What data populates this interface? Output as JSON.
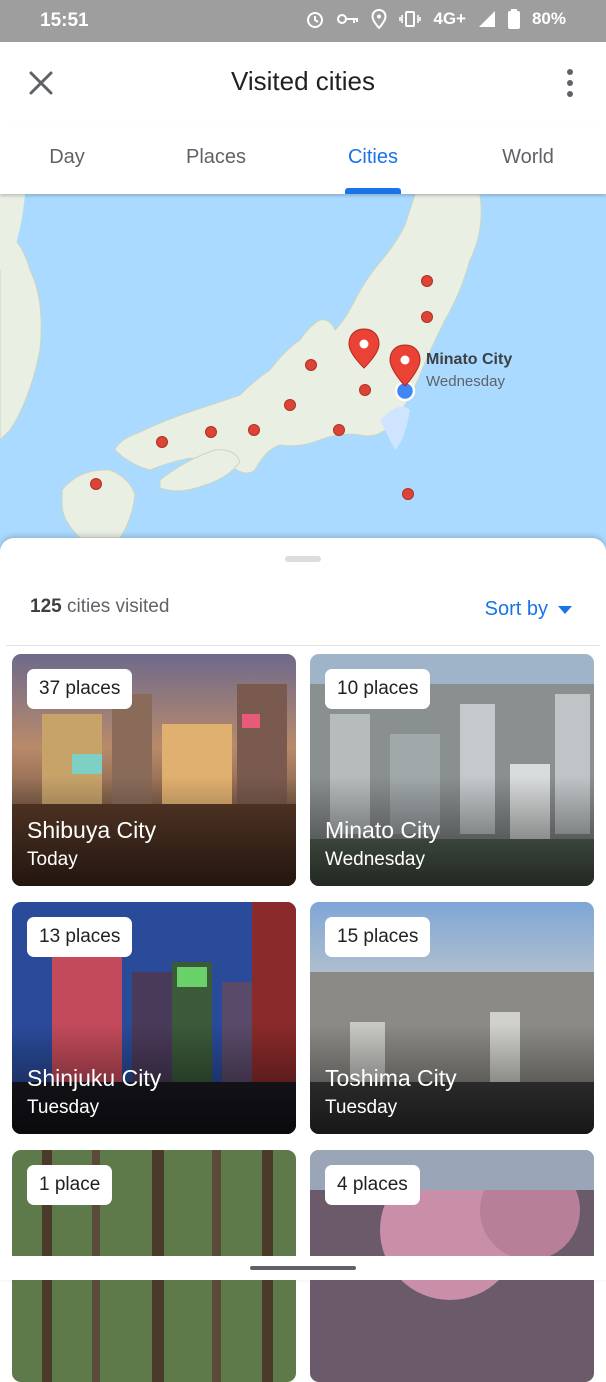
{
  "status_bar": {
    "time": "15:51",
    "network": "4G+",
    "battery": "80%"
  },
  "app_bar": {
    "title": "Visited cities",
    "close_icon": "close-icon",
    "more_icon": "more-vert-icon"
  },
  "tabs": [
    {
      "label": "Day",
      "active": false
    },
    {
      "label": "Places",
      "active": false
    },
    {
      "label": "Cities",
      "active": true
    },
    {
      "label": "World",
      "active": false
    }
  ],
  "map": {
    "selected_city": "Minato City",
    "selected_when": "Wednesday"
  },
  "summary": {
    "count": "125",
    "count_suffix": "cities visited",
    "sort_label": "Sort by"
  },
  "colors": {
    "accent": "#1a73e8",
    "pin_red": "#db4437",
    "water": "#aadaff",
    "land": "#e8f0e0"
  },
  "cards": [
    {
      "badge": "37 places",
      "name": "Shibuya City",
      "when": "Today"
    },
    {
      "badge": "10 places",
      "name": "Minato City",
      "when": "Wednesday"
    },
    {
      "badge": "13 places",
      "name": "Shinjuku City",
      "when": "Tuesday"
    },
    {
      "badge": "15 places",
      "name": "Toshima City",
      "when": "Tuesday"
    },
    {
      "badge": "1 place",
      "name": "",
      "when": ""
    },
    {
      "badge": "4 places",
      "name": "",
      "when": ""
    }
  ]
}
